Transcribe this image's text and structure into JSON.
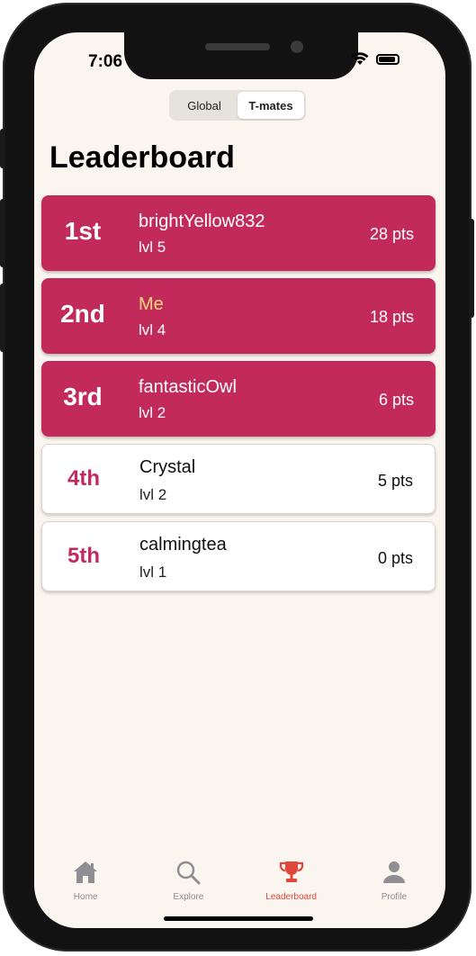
{
  "status_bar": {
    "time": "7:06"
  },
  "segmented_control": {
    "options": [
      {
        "label": "Global",
        "selected": false
      },
      {
        "label": "T-mates",
        "selected": true
      }
    ]
  },
  "page": {
    "title": "Leaderboard"
  },
  "leaderboard": [
    {
      "rank": "1st",
      "name": "brightYellow832",
      "level": "lvl 5",
      "points": "28 pts",
      "highlighted": true
    },
    {
      "rank": "2nd",
      "name": "Me",
      "level": "lvl 4",
      "points": "18 pts",
      "highlighted": true,
      "is_me": true
    },
    {
      "rank": "3rd",
      "name": "fantasticOwl",
      "level": "lvl 2",
      "points": "6 pts",
      "highlighted": true
    },
    {
      "rank": "4th",
      "name": "Crystal",
      "level": "lvl 2",
      "points": "5 pts",
      "highlighted": false
    },
    {
      "rank": "5th",
      "name": "calmingtea",
      "level": "lvl 1",
      "points": "0 pts",
      "highlighted": false
    }
  ],
  "tab_bar": {
    "tabs": [
      {
        "label": "Home",
        "icon": "home-icon",
        "active": false
      },
      {
        "label": "Explore",
        "icon": "search-icon",
        "active": false
      },
      {
        "label": "Leaderboard",
        "icon": "trophy-icon",
        "active": true
      },
      {
        "label": "Profile",
        "icon": "person-icon",
        "active": false
      }
    ]
  },
  "colors": {
    "accent": "#c32a5c",
    "me_name": "#f7d77c",
    "tab_active": "#e0463c",
    "tab_inactive": "#8e8e93",
    "background": "#faf5ee"
  }
}
